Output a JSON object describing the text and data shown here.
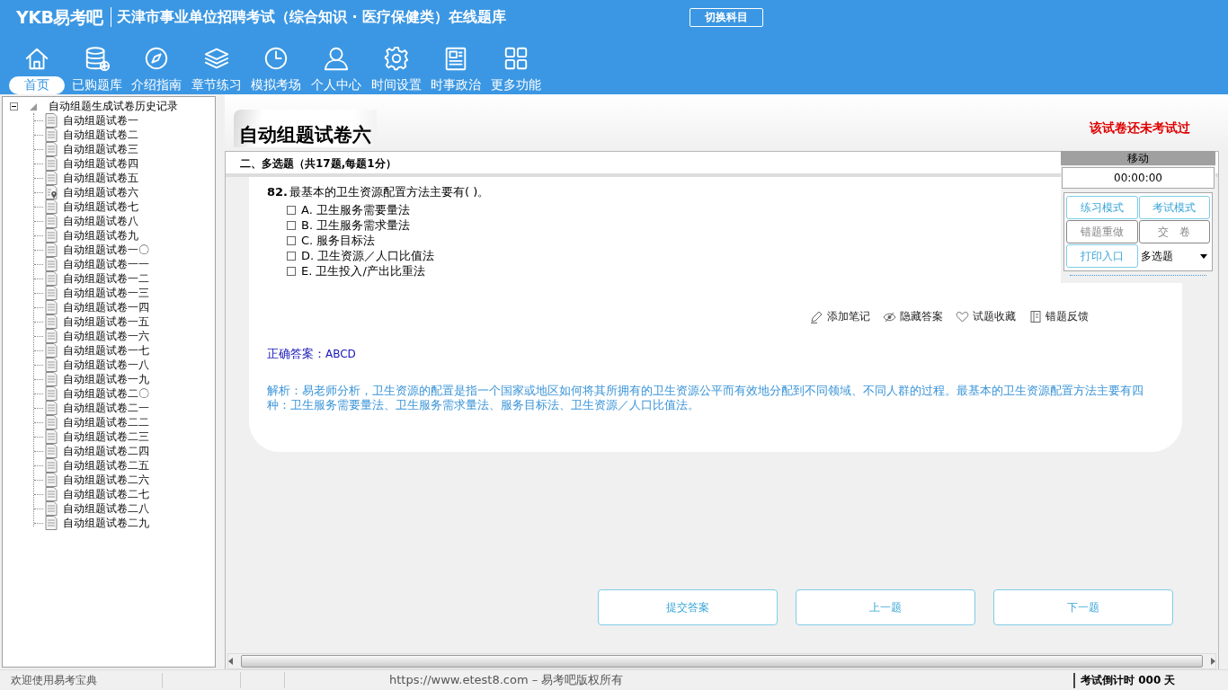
{
  "header": {
    "logo": "YKB易考吧",
    "title": "天津市事业单位招聘考试（综合知识 · 医疗保健类）在线题库",
    "switch_button": "切换科目"
  },
  "nav": [
    {
      "label": "首页",
      "selected": true
    },
    {
      "label": "已购题库",
      "selected": false
    },
    {
      "label": "介绍指南",
      "selected": false
    },
    {
      "label": "章节练习",
      "selected": false
    },
    {
      "label": "模拟考场",
      "selected": false
    },
    {
      "label": "个人中心",
      "selected": false
    },
    {
      "label": "时间设置",
      "selected": false
    },
    {
      "label": "时事政治",
      "selected": false
    },
    {
      "label": "更多功能",
      "selected": false
    }
  ],
  "tree": {
    "label": "自动组题生成试卷历史记录",
    "expanded": true,
    "children": [
      {
        "label": "自动组题试卷一",
        "current": false
      },
      {
        "label": "自动组题试卷二",
        "current": false
      },
      {
        "label": "自动组题试卷三",
        "current": false
      },
      {
        "label": "自动组题试卷四",
        "current": false
      },
      {
        "label": "自动组题试卷五",
        "current": false
      },
      {
        "label": "自动组题试卷六",
        "current": true
      },
      {
        "label": "自动组题试卷七",
        "current": false
      },
      {
        "label": "自动组题试卷八",
        "current": false
      },
      {
        "label": "自动组题试卷九",
        "current": false
      },
      {
        "label": "自动组题试卷一〇",
        "current": false
      },
      {
        "label": "自动组题试卷一一",
        "current": false
      },
      {
        "label": "自动组题试卷一二",
        "current": false
      },
      {
        "label": "自动组题试卷一三",
        "current": false
      },
      {
        "label": "自动组题试卷一四",
        "current": false
      },
      {
        "label": "自动组题试卷一五",
        "current": false
      },
      {
        "label": "自动组题试卷一六",
        "current": false
      },
      {
        "label": "自动组题试卷一七",
        "current": false
      },
      {
        "label": "自动组题试卷一八",
        "current": false
      },
      {
        "label": "自动组题试卷一九",
        "current": false
      },
      {
        "label": "自动组题试卷二〇",
        "current": false
      },
      {
        "label": "自动组题试卷二一",
        "current": false
      },
      {
        "label": "自动组题试卷二二",
        "current": false
      },
      {
        "label": "自动组题试卷二三",
        "current": false
      },
      {
        "label": "自动组题试卷二四",
        "current": false
      },
      {
        "label": "自动组题试卷二五",
        "current": false
      },
      {
        "label": "自动组题试卷二六",
        "current": false
      },
      {
        "label": "自动组题试卷二七",
        "current": false
      },
      {
        "label": "自动组题试卷二八",
        "current": false
      },
      {
        "label": "自动组题试卷二九",
        "current": false
      }
    ]
  },
  "paper": {
    "title": "自动组题试卷六",
    "status": "该试卷还未考试过",
    "section": "二、多选题（共17题,每题1分）"
  },
  "question": {
    "number": "82.",
    "text": "最基本的卫生资源配置方法主要有( )。",
    "options": [
      {
        "text": "A. 卫生服务需要量法",
        "checked": false
      },
      {
        "text": "B. 卫生服务需求量法",
        "checked": false
      },
      {
        "text": "C. 服务目标法",
        "checked": false
      },
      {
        "text": "D. 卫生资源／人口比值法",
        "checked": false
      },
      {
        "text": "E. 卫生投入/产出比重法",
        "checked": false
      }
    ],
    "actions": [
      "添加笔记",
      "隐藏答案",
      "试题收藏",
      "错题反馈"
    ],
    "answer_label": "正确答案：",
    "answer": "ABCD",
    "explanation": "解析：易老师分析，卫生资源的配置是指一个国家或地区如何将其所拥有的卫生资源公平而有效地分配到不同领域、不同人群的过程。最基本的卫生资源配置方法主要有四种：卫生服务需要量法、卫生服务需求量法、服务目标法、卫生资源／人口比值法。"
  },
  "bottom_buttons": [
    "提交答案",
    "上一题",
    "下一题"
  ],
  "control": {
    "title": "移动",
    "timer": "00:00:00",
    "buttons": [
      {
        "label": "练习模式",
        "disabled": false
      },
      {
        "label": "考试模式",
        "disabled": false
      },
      {
        "label": "错题重做",
        "disabled": true
      },
      {
        "label": "交　卷",
        "disabled": true
      },
      {
        "label": "打印入口",
        "disabled": false
      }
    ],
    "type_select": "多选题"
  },
  "status_bar": {
    "welcome": "欢迎使用易考宝典",
    "copyright": "https://www.etest8.com – 易考吧版权所有",
    "countdown": "考试倒计时 000 天"
  }
}
